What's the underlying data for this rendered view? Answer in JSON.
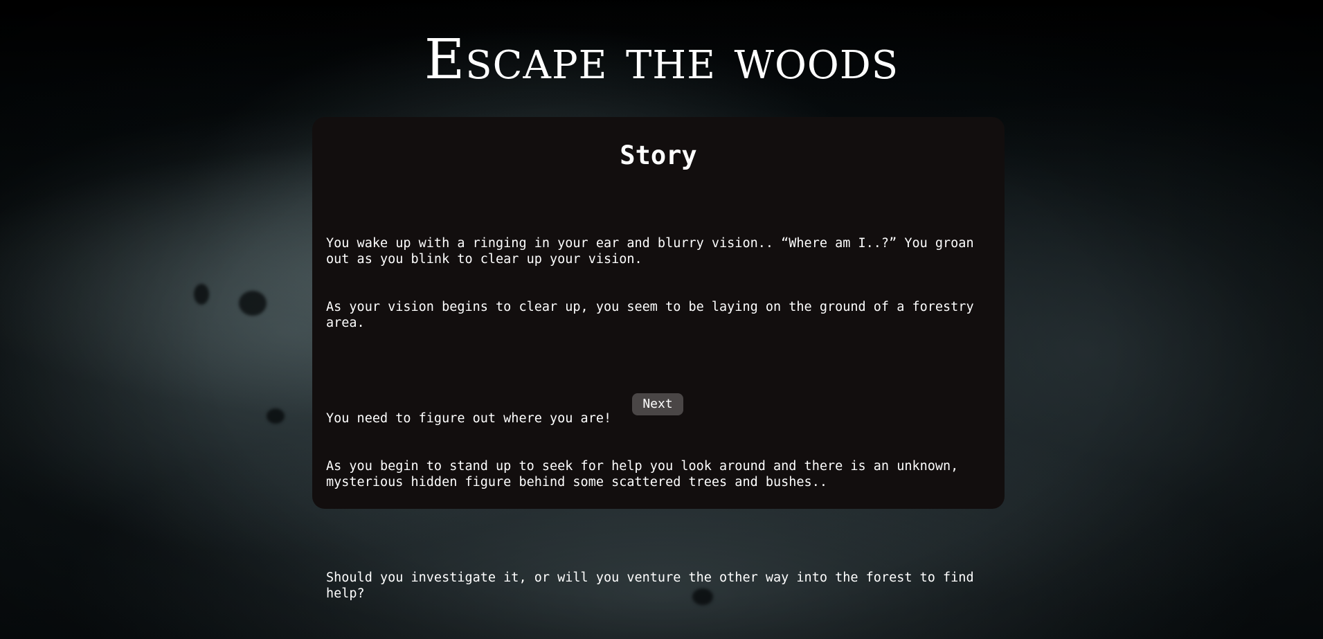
{
  "page": {
    "title": "Escape the woods",
    "background_color": "#030708",
    "accent_text_color": "#ffffff"
  },
  "story_card": {
    "heading": "Story",
    "card_color": "#120e0e",
    "paragraphs": {
      "p1_line1": "You wake up with a ringing in your ear and blurry vision.. “Where am I..?” You groan out as you blink to clear up your vision.",
      "p1_line2": "As your vision begins to clear up, you seem to be laying on the ground of a forestry area.",
      "p2_line1": "You need to figure out where you are!",
      "p2_line2": "As you begin to stand up to seek for help you look around and there is an unknown, mysterious hidden figure behind some scattered trees and bushes..",
      "p3_line1": "Should you investigate it, or will you venture the other way into the forest to find help?"
    },
    "next_button_label": "Next",
    "button_color": "#4a4646"
  }
}
